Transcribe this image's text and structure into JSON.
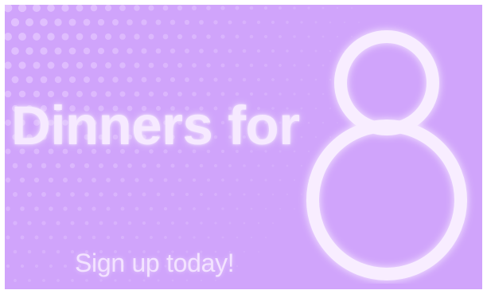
{
  "banner": {
    "headline": "Dinners for",
    "number": "8",
    "cta": "Sign up today!"
  },
  "colors": {
    "background": "#d0a4fb",
    "text": "#f6e9ff",
    "dots": "#e6c9ff"
  }
}
